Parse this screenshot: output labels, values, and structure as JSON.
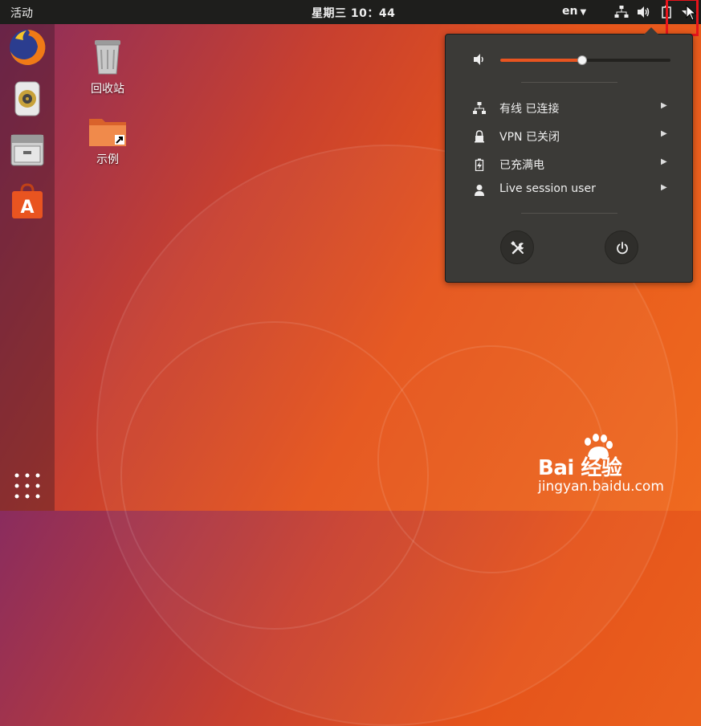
{
  "topbar": {
    "activities": "活动",
    "clock": "星期三 10：44",
    "language": "en"
  },
  "dock": {
    "items": [
      "firefox-icon",
      "rhythmbox-icon",
      "files-icon",
      "software-center-icon"
    ]
  },
  "desktop": {
    "icons": [
      {
        "label": "回收站",
        "icon": "trash-icon"
      },
      {
        "label": "示例",
        "icon": "folder-icon"
      }
    ]
  },
  "system_menu": {
    "volume": {
      "level": 0.48
    },
    "rows": [
      {
        "label": "有线 已连接",
        "icon": "network-wired-icon"
      },
      {
        "label": "VPN 已关闭",
        "icon": "vpn-lock-icon"
      },
      {
        "label": "已充满电",
        "icon": "battery-icon"
      },
      {
        "label": "Live session user",
        "icon": "user-icon"
      }
    ]
  },
  "watermark": {
    "brand": "Bai  经验",
    "url": "jingyan.baidu.com"
  },
  "colors": {
    "accent": "#e95420",
    "panel": "#1e1e1c",
    "menu_bg": "#3b3a37",
    "highlight_box": "#e8141b"
  }
}
